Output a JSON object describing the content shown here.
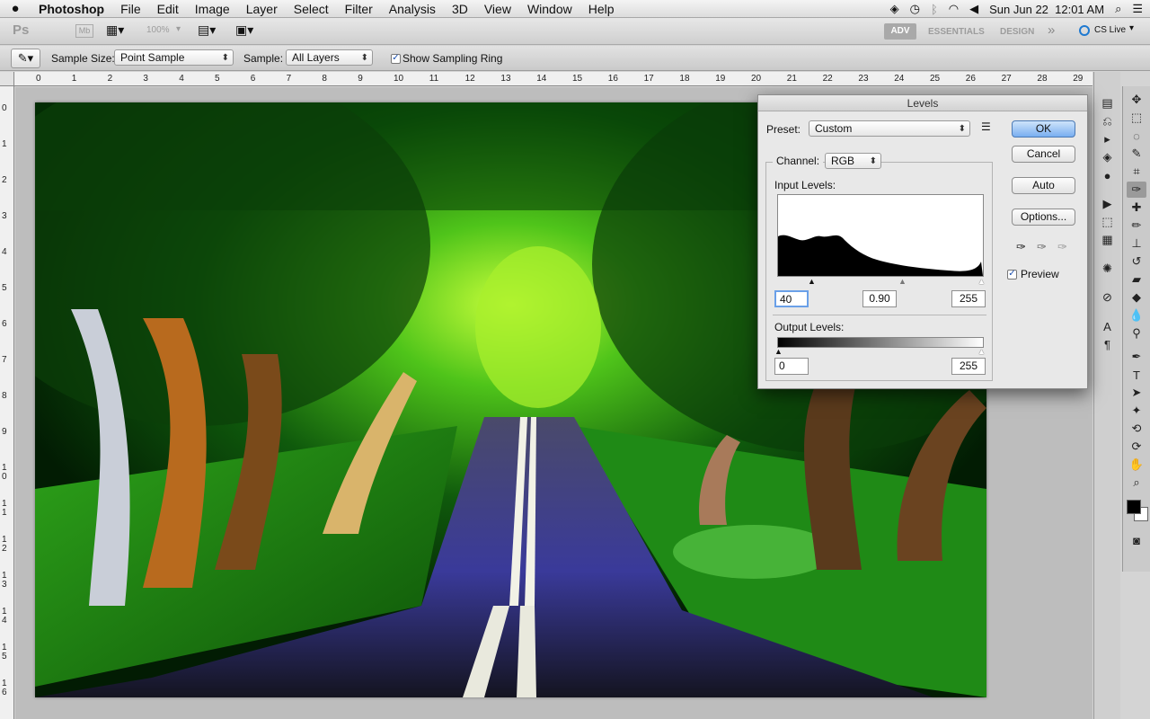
{
  "menubar": {
    "app": "Photoshop",
    "items": [
      "File",
      "Edit",
      "Image",
      "Layer",
      "Select",
      "Filter",
      "Analysis",
      "3D",
      "View",
      "Window",
      "Help"
    ],
    "clock": "Sun Jun 22  12:01 AM"
  },
  "appbar": {
    "ps_logo": "Ps",
    "mb_logo": "Mb",
    "zoom": "100%",
    "workspaces": [
      "ADV",
      "ESSENTIALS",
      "DESIGN"
    ],
    "more": "»",
    "cs_live": "CS Live"
  },
  "options": {
    "sample_size_label": "Sample Size:",
    "sample_size_value": "Point Sample",
    "sample_label": "Sample:",
    "sample_value": "All Layers",
    "show_ring_label": "Show Sampling Ring"
  },
  "rulers": {
    "top": [
      "0",
      "1",
      "2",
      "3",
      "4",
      "5",
      "6",
      "7",
      "8",
      "9",
      "10",
      "11",
      "12",
      "13",
      "14",
      "15",
      "16",
      "17",
      "18",
      "19",
      "20",
      "21",
      "22",
      "23",
      "24",
      "25",
      "26",
      "27",
      "28",
      "29"
    ],
    "left": [
      "0",
      "1",
      "2",
      "3",
      "4",
      "5",
      "6",
      "7",
      "8",
      "9",
      "10",
      "11",
      "12",
      "13",
      "14",
      "15",
      "16"
    ]
  },
  "levels": {
    "title": "Levels",
    "preset_label": "Preset:",
    "preset_value": "Custom",
    "channel_label": "Channel:",
    "channel_value": "RGB",
    "input_label": "Input Levels:",
    "input_black": "40",
    "input_gamma": "0.90",
    "input_white": "255",
    "output_label": "Output Levels:",
    "output_black": "0",
    "output_white": "255",
    "ok": "OK",
    "cancel": "Cancel",
    "auto": "Auto",
    "options": "Options...",
    "preview": "Preview"
  },
  "colors": {
    "accent_button": "#79aef0",
    "foreground_swatch": "#000000",
    "background_swatch": "#ffffff"
  }
}
